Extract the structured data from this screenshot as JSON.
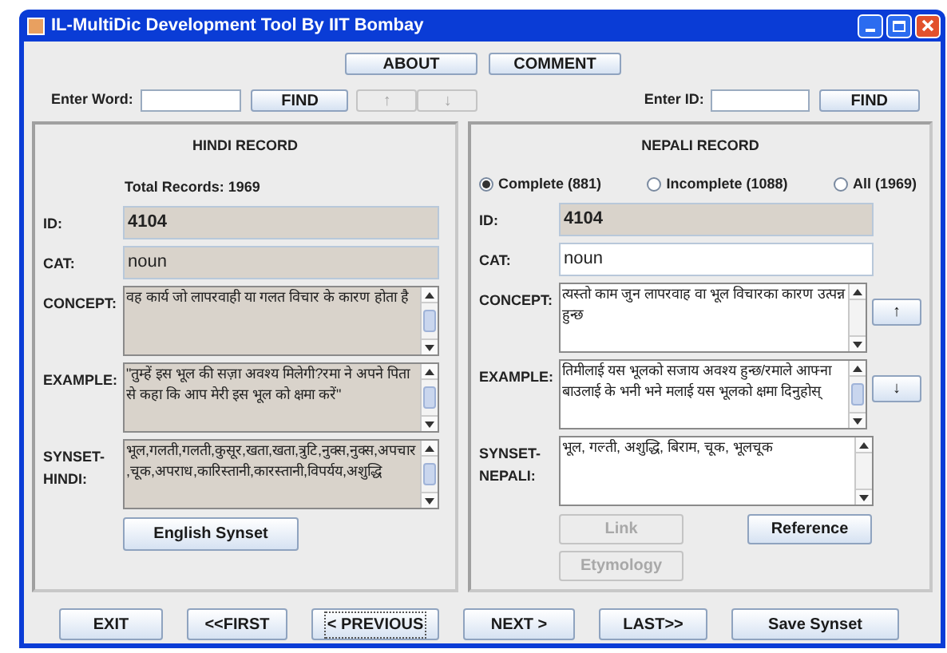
{
  "window": {
    "title": "IL-MultiDic Development Tool By IIT Bombay"
  },
  "top_buttons": [
    "ABOUT",
    "COMMENT"
  ],
  "word_search": {
    "label": "Enter Word:",
    "button": "FIND",
    "arrows": [
      "↑",
      "↓"
    ]
  },
  "id_search": {
    "label": "Enter ID:",
    "button": "FIND"
  },
  "hindi_record": {
    "title": "HINDI RECORD",
    "total": "Total Records: 1969",
    "fields": [
      {
        "label": "ID:",
        "value": "4104",
        "kind": "line",
        "bold": true,
        "editable": false
      },
      {
        "label": "CAT:",
        "value": "noun",
        "kind": "line",
        "bold": false,
        "editable": false
      },
      {
        "label": "CONCEPT:",
        "value": "वह कार्य जो लापरवाही या गलत विचार के कारण होता है",
        "kind": "area",
        "editable": false
      },
      {
        "label": "EXAMPLE:",
        "value": "\"तुम्हें इस भूल की सज़ा अवश्य मिलेगी?रमा ने अपने पिता से कहा कि आप मेरी इस भूल को क्षमा करें\"",
        "kind": "area",
        "editable": false
      },
      {
        "label": "SYNSET-HINDI:",
        "value": "भूल,गलती,गलती,कुसूर,खता,खता,त्रुटि,नुक्स,नुक्स,अपचार,चूक,अपराध,कारिस्तानी,कारस्तानी,विपर्यय,अशुद्धि",
        "kind": "area",
        "editable": false
      }
    ],
    "button": "English Synset"
  },
  "nepali_record": {
    "title": "NEPALI RECORD",
    "filters": [
      {
        "label": "Complete (881)",
        "selected": true
      },
      {
        "label": "Incomplete (1088)",
        "selected": false
      },
      {
        "label": "All (1969)",
        "selected": false
      }
    ],
    "fields": [
      {
        "label": "ID:",
        "value": "4104",
        "kind": "line",
        "bold": true,
        "editable": false
      },
      {
        "label": "CAT:",
        "value": "noun",
        "kind": "line",
        "bold": false,
        "editable": true
      },
      {
        "label": "CONCEPT:",
        "value": "त्यस्तो काम जुन लापरवाह वा भूल विचारका कारण उत्पन्न हुन्छ",
        "kind": "area",
        "editable": true,
        "side_button": "↑"
      },
      {
        "label": "EXAMPLE:",
        "value": "तिमीलाई यस भूलको सजाय अवश्य हुन्छ/रमाले आफ्ना बाउलाई के भनी भने मलाई यस भूलको क्षमा दिनुहोस्",
        "kind": "area",
        "editable": true,
        "side_button": "↓"
      },
      {
        "label": "SYNSET-NEPALI:",
        "value": "भूल, गल्ती, अशुद्धि, बिराम, चूक, भूलचूक",
        "kind": "area",
        "editable": true
      }
    ],
    "actions": [
      {
        "label": "Link",
        "disabled": true
      },
      {
        "label": "Reference",
        "disabled": false
      },
      {
        "label": "Etymology",
        "disabled": true
      }
    ]
  },
  "nav_buttons": [
    {
      "label": "EXIT",
      "focused": false
    },
    {
      "label": "<<FIRST",
      "focused": false
    },
    {
      "label": "< PREVIOUS",
      "focused": true
    },
    {
      "label": "NEXT >",
      "focused": false
    },
    {
      "label": "LAST>>",
      "focused": false
    },
    {
      "label": "Save Synset",
      "focused": false
    }
  ]
}
